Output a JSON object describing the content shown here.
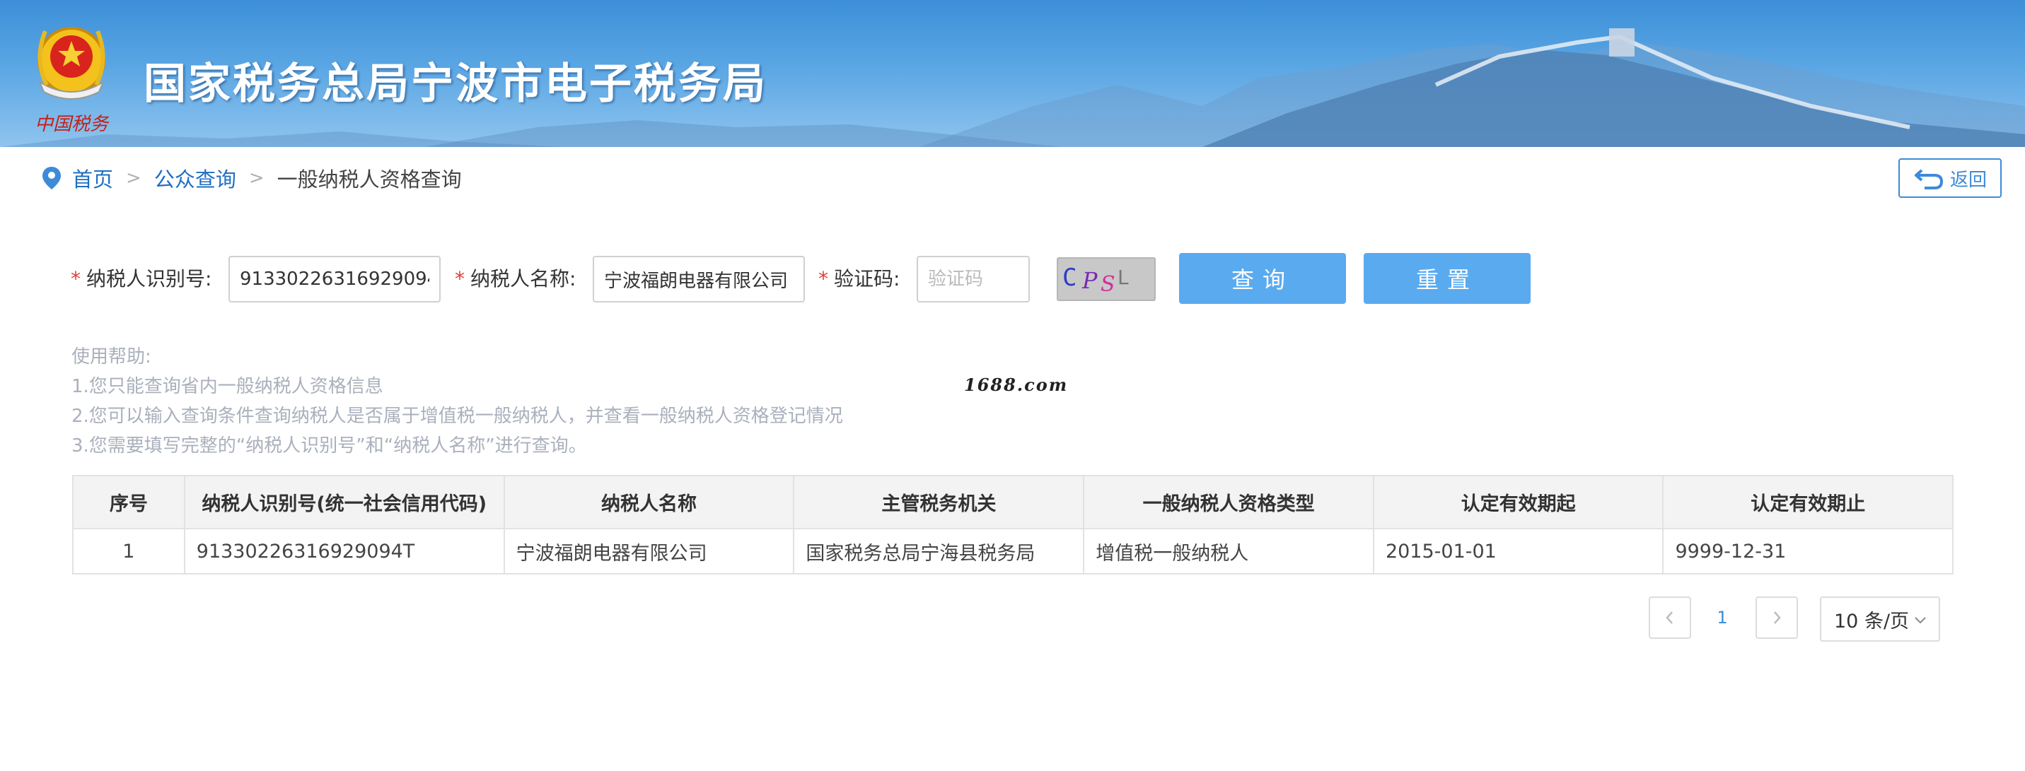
{
  "header": {
    "site_title": "国家税务总局宁波市电子税务局",
    "logo_caption": "中国税务"
  },
  "breadcrumb": {
    "home": "首页",
    "section": "公众查询",
    "current": "一般纳税人资格查询",
    "separator": ">"
  },
  "back_button": {
    "label": "返回"
  },
  "form": {
    "taxpayer_id_label": "纳税人识别号:",
    "taxpayer_id_value": "91330226316929094T",
    "taxpayer_name_label": "纳税人名称:",
    "taxpayer_name_value": "宁波福朗电器有限公司",
    "captcha_label": "验证码:",
    "captcha_placeholder": "验证码",
    "captcha_image_text": "CPSL",
    "required_mark": "*",
    "query_button": "查询",
    "reset_button": "重置"
  },
  "help": {
    "title": "使用帮助:",
    "lines": [
      "1.您只能查询省内一般纳税人资格信息",
      "2.您可以输入查询条件查询纳税人是否属于增值税一般纳税人，并查看一般纳税人资格登记情况",
      "3.您需要填写完整的“纳税人识别号”和“纳税人名称”进行查询。"
    ]
  },
  "watermark": "1688.com",
  "table": {
    "columns": [
      "序号",
      "纳税人识别号(统一社会信用代码)",
      "纳税人名称",
      "主管税务机关",
      "一般纳税人资格类型",
      "认定有效期起",
      "认定有效期止"
    ],
    "rows": [
      [
        "1",
        "91330226316929094T",
        "宁波福朗电器有限公司",
        "国家税务总局宁海县税务局",
        "增值税一般纳税人",
        "2015-01-01",
        "9999-12-31"
      ]
    ]
  },
  "pagination": {
    "current_page": "1",
    "page_size_label": "10 条/页"
  },
  "colors": {
    "primary_button": "#5aaaf0",
    "link": "#1e6fc2",
    "required_star": "#e0403a",
    "help_text": "#aab0bc"
  },
  "icons": {
    "location": "location-pin-icon",
    "back": "return-arrow-icon",
    "prev": "chevron-left-icon",
    "next": "chevron-right-icon",
    "dropdown": "chevron-down-icon"
  }
}
